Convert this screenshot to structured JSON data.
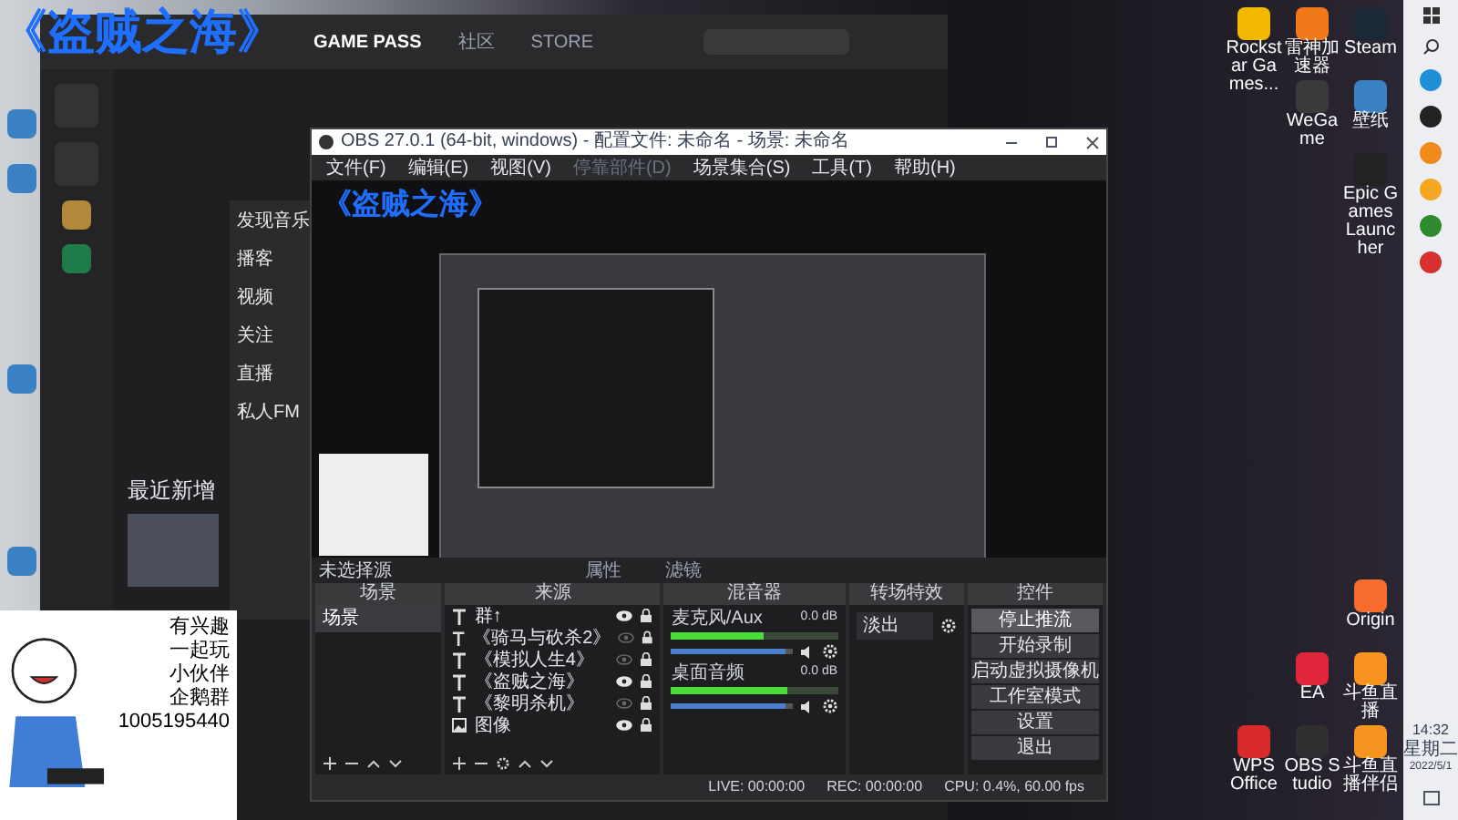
{
  "overlay_title": "《盗贼之海》",
  "back_window": {
    "tabs": [
      {
        "label": "GAME PASS",
        "selected": true
      },
      {
        "label": "社区",
        "selected": false
      },
      {
        "label": "STORE",
        "selected": false
      }
    ]
  },
  "music_app": {
    "nav": [
      "发现音乐",
      "播客",
      "视频",
      "关注",
      "直播",
      "私人FM"
    ],
    "section": "最近新增"
  },
  "obs": {
    "title": "OBS 27.0.1 (64-bit, windows) - 配置文件: 未命名 - 场景: 未命名",
    "menu": [
      {
        "label": "文件(F)",
        "disabled": false
      },
      {
        "label": "编辑(E)",
        "disabled": false
      },
      {
        "label": "视图(V)",
        "disabled": false
      },
      {
        "label": "停靠部件(D)",
        "disabled": true
      },
      {
        "label": "场景集合(S)",
        "disabled": false
      },
      {
        "label": "工具(T)",
        "disabled": false
      },
      {
        "label": "帮助(H)",
        "disabled": false
      }
    ],
    "preview_overlay": "《盗贼之海》",
    "source_bar": {
      "label": "未选择源",
      "buttons": [
        "属性",
        "滤镜"
      ]
    },
    "scenes": {
      "title": "场景",
      "items": [
        {
          "label": "场景",
          "selected": true
        }
      ]
    },
    "sources": {
      "title": "来源",
      "items": [
        {
          "label": "群↑",
          "kind": "text",
          "visible": true
        },
        {
          "label": "《骑马与砍杀2》",
          "kind": "text",
          "visible": false
        },
        {
          "label": "《模拟人生4》",
          "kind": "text",
          "visible": false
        },
        {
          "label": "《盗贼之海》",
          "kind": "text",
          "visible": true
        },
        {
          "label": "《黎明杀机》",
          "kind": "text",
          "visible": false
        },
        {
          "label": "图像",
          "kind": "image",
          "visible": true
        }
      ]
    },
    "mixer": {
      "title": "混音器",
      "channels": [
        {
          "name": "麦克风/Aux",
          "reading": "0.0 dB",
          "level": 0.55,
          "fader": {
            "level": 0.95
          }
        },
        {
          "name": "桌面音频",
          "reading": "0.0 dB",
          "level": 0.7,
          "fader": {
            "level": 0.95
          }
        }
      ]
    },
    "transitions": {
      "title": "转场特效",
      "value": "淡出"
    },
    "controls": {
      "title": "控件",
      "buttons": [
        {
          "label": "停止推流",
          "active": true
        },
        {
          "label": "开始录制",
          "active": false
        },
        {
          "label": "启动虚拟摄像机",
          "active": false
        },
        {
          "label": "工作室模式",
          "active": false
        },
        {
          "label": "设置",
          "active": false
        },
        {
          "label": "退出",
          "active": false
        }
      ]
    },
    "status": {
      "live": "LIVE: 00:00:00",
      "rec": "REC: 00:00:00",
      "cpu": "CPU: 0.4%, 60.00 fps"
    }
  },
  "desktop_icons": [
    {
      "label": "Rockstar Games...",
      "color": "#f5b800"
    },
    {
      "label": "雷神加速器",
      "color": "#f07a1a"
    },
    {
      "label": "Steam",
      "color": "#1b2838"
    },
    {
      "label": "WeGame",
      "color": "#3a3a3a"
    },
    {
      "label": "壁纸",
      "color": "#3b82c4"
    },
    {
      "label": "Epic Games Launcher",
      "color": "#222222"
    },
    {
      "label": "Origin",
      "color": "#f56c2d"
    },
    {
      "label": "EA",
      "color": "#e0263a"
    },
    {
      "label": "斗鱼直播",
      "color": "#f7931e"
    },
    {
      "label": "WPS Office",
      "color": "#d82a2a"
    },
    {
      "label": "OBS Studio",
      "color": "#302e31"
    },
    {
      "label": "斗鱼直播伴侣",
      "color": "#f7941f"
    }
  ],
  "taskbar": {
    "time": "14:32",
    "weekday": "星期二",
    "date": "2022/5/1"
  },
  "sticker": {
    "lines": [
      "有兴趣",
      "一起玩",
      "小伙伴",
      "企鹅群",
      "1005195440"
    ]
  }
}
